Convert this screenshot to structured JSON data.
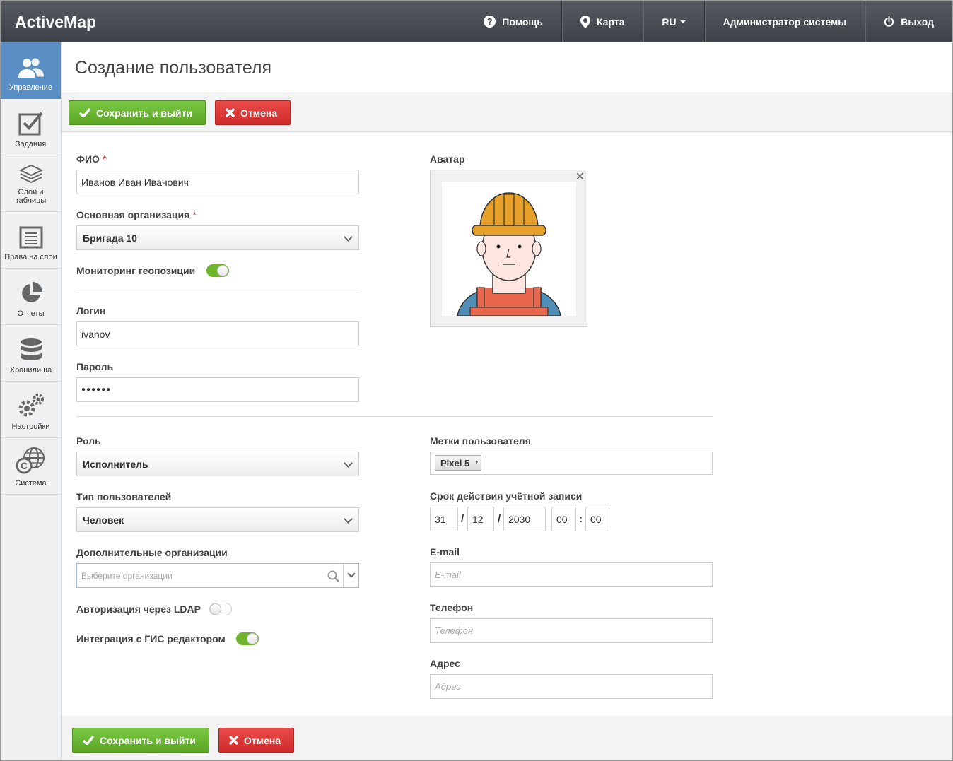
{
  "app": {
    "brand": "ActiveMap"
  },
  "topnav": {
    "help": "Помощь",
    "map": "Карта",
    "lang": "RU",
    "user": "Администратор системы",
    "logout": "Выход"
  },
  "sidebar": {
    "items": [
      {
        "label": "Управление",
        "icon": "users-icon",
        "active": true
      },
      {
        "label": "Задания",
        "icon": "checkbox-icon"
      },
      {
        "label": "Слои и таблицы",
        "icon": "layers-icon"
      },
      {
        "label": "Права на слои",
        "icon": "document-list-icon"
      },
      {
        "label": "Отчеты",
        "icon": "pie-chart-icon"
      },
      {
        "label": "Хранилища",
        "icon": "database-icon"
      },
      {
        "label": "Настройки",
        "icon": "gears-icon"
      },
      {
        "label": "Система",
        "icon": "globe-icon"
      }
    ]
  },
  "page": {
    "title": "Создание пользователя"
  },
  "toolbar": {
    "save_label": "Сохранить и выйти",
    "cancel_label": "Отмена"
  },
  "form": {
    "fio": {
      "label": "ФИО",
      "required": "*",
      "value": "Иванов Иван Иванович"
    },
    "org": {
      "label": "Основная организация",
      "required": "*",
      "value": "Бригада 10"
    },
    "geo": {
      "label": "Мониторинг геопозиции",
      "on": true
    },
    "login": {
      "label": "Логин",
      "value": "ivanov"
    },
    "password": {
      "label": "Пароль",
      "value": "●●●●●●"
    },
    "avatar": {
      "label": "Аватар",
      "close": "✕"
    },
    "role": {
      "label": "Роль",
      "value": "Исполнитель"
    },
    "user_type": {
      "label": "Тип пользователей",
      "value": "Человек"
    },
    "extra_orgs": {
      "label": "Дополнительные организации",
      "placeholder": "Выберите организации"
    },
    "ldap": {
      "label": "Авторизация через LDAP",
      "on": false
    },
    "gis": {
      "label": "Интеграция с ГИС редактором",
      "on": true
    },
    "tags": {
      "label": "Метки пользователя",
      "items": [
        "Pixel 5"
      ]
    },
    "expiry": {
      "label": "Срок действия учётной записи",
      "day": "31",
      "month": "12",
      "year": "2030",
      "hour": "00",
      "minute": "00",
      "sep_date": "/",
      "sep_time": ":"
    },
    "email": {
      "label": "E-mail",
      "placeholder": "E-mail"
    },
    "phone": {
      "label": "Телефон",
      "placeholder": "Телефон"
    },
    "address": {
      "label": "Адрес",
      "placeholder": "Адрес"
    }
  },
  "colors": {
    "accent": "#5a8fc6",
    "save": "#6ab634",
    "cancel": "#dc3a38",
    "toggle_on": "#6fb42c"
  }
}
